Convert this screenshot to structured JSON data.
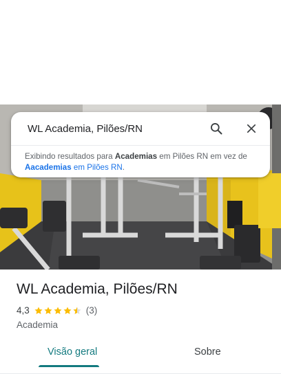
{
  "search": {
    "value": "WL Academia, Pilões/RN",
    "placeholder": ""
  },
  "notice": {
    "prefix": "Exibindo resultados para ",
    "shown_term": "Academias",
    "middle": " em Pilões RN em vez de ",
    "alt_term": "Aacademias",
    "alt_suffix": " em Pilões RN",
    "end": "."
  },
  "place": {
    "name": "WL Academia, Pilões/RN",
    "rating": "4,3",
    "rating_value": 4.3,
    "reviews": "(3)",
    "category": "Academia"
  },
  "tabs": [
    {
      "label": "Visão geral",
      "active": true
    },
    {
      "label": "Sobre",
      "active": false
    }
  ],
  "colors": {
    "accent": "#137a7f",
    "star": "#fbbc04",
    "link": "#1a73e8"
  },
  "icons": {
    "search": "search-icon",
    "close": "close-icon",
    "star": "star-icon"
  }
}
